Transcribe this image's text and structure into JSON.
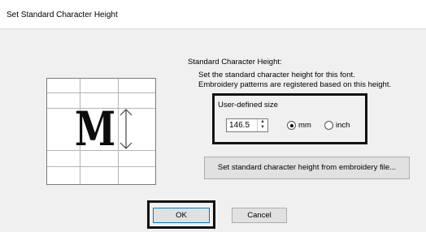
{
  "window": {
    "title": "Set Standard Character Height"
  },
  "section": {
    "heading": "Standard Character Height:",
    "desc_line1": "Set the standard character height for this font.",
    "desc_line2": "Embroidery patterns are registered based on this height."
  },
  "illustration": {
    "glyph": "M"
  },
  "user_size": {
    "label": "User-defined size",
    "value": "146.5",
    "unit_mm_label": "mm",
    "unit_inch_label": "inch",
    "selected_unit": "mm"
  },
  "buttons": {
    "from_file": "Set standard character height from embroidery file...",
    "ok": "OK",
    "cancel": "Cancel"
  }
}
